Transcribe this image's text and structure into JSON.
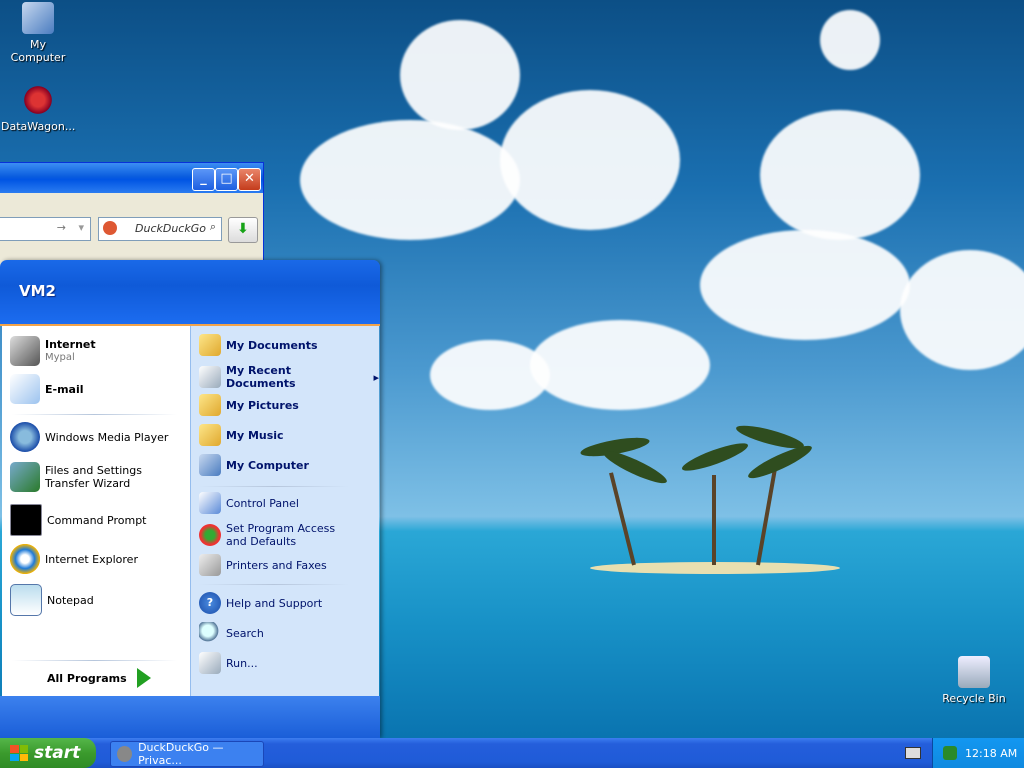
{
  "desktop": {
    "icons": [
      {
        "label": "My Computer",
        "icon": "my-computer-icon"
      },
      {
        "label": "DataWagon...",
        "icon": "datawagon-shortcut-icon"
      },
      {
        "label": "Recycle Bin",
        "icon": "recycle-bin-icon"
      }
    ]
  },
  "browser": {
    "search_placeholder": "DuckDuckGo",
    "buttons": {
      "minimize": "_",
      "maximize": "□",
      "close": "✕",
      "go": "⬇"
    }
  },
  "start_menu": {
    "user": "VM2",
    "pinned": [
      {
        "label": "Internet",
        "sublabel": "Mypal",
        "icon": "raccoon-browser-icon"
      },
      {
        "label": "E-mail",
        "sublabel": "",
        "icon": "email-icon"
      }
    ],
    "recent": [
      {
        "label": "Windows Media Player",
        "icon": "media-player-icon"
      },
      {
        "label": "Files and Settings Transfer Wizard",
        "icon": "transfer-wizard-icon"
      },
      {
        "label": "Command Prompt",
        "icon": "command-prompt-icon"
      },
      {
        "label": "Internet Explorer",
        "icon": "internet-explorer-icon"
      },
      {
        "label": "Notepad",
        "icon": "notepad-icon"
      }
    ],
    "all_programs": "All Programs",
    "right_places": [
      {
        "label": "My Documents",
        "icon": "folder-documents-icon"
      },
      {
        "label": "My Recent Documents",
        "icon": "recent-documents-icon"
      },
      {
        "label": "My Pictures",
        "icon": "folder-pictures-icon"
      },
      {
        "label": "My Music",
        "icon": "folder-music-icon"
      },
      {
        "label": "My Computer",
        "icon": "my-computer-icon"
      }
    ],
    "right_settings": [
      {
        "label": "Control Panel",
        "icon": "control-panel-icon"
      },
      {
        "label": "Set Program Access and Defaults",
        "icon": "program-access-icon"
      },
      {
        "label": "Printers and Faxes",
        "icon": "printer-icon"
      }
    ],
    "right_tools": [
      {
        "label": "Help and Support",
        "icon": "help-icon"
      },
      {
        "label": "Search",
        "icon": "search-icon"
      },
      {
        "label": "Run...",
        "icon": "run-icon"
      }
    ]
  },
  "taskbar": {
    "start_label": "start",
    "task": "DuckDuckGo — Privac...",
    "clock": "12:18 AM"
  },
  "colors": {
    "taskbar": "#245edb",
    "start_button": "#3b9b2d",
    "start_menu_right": "#d3e5fa"
  }
}
